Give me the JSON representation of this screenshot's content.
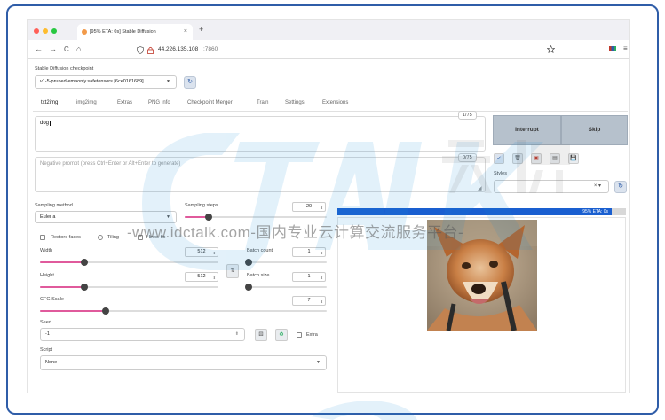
{
  "browser": {
    "tab_title": "[95% ETA: 0s] Stable Diffusion",
    "tab_close": "×",
    "new_tab": "+",
    "url_host": "44.226.135.108",
    "url_port": ":7860",
    "back": "←",
    "forward": "→",
    "reload": "C",
    "home": "⌂"
  },
  "checkpoint": {
    "label": "Stable Diffusion checkpoint",
    "value": "v1-5-pruned-emaonly.safetensors [6ce0161689]"
  },
  "tabs": [
    "txt2img",
    "img2img",
    "Extras",
    "PNG Info",
    "Checkpoint Merger",
    "Train",
    "Settings",
    "Extensions"
  ],
  "prompt": {
    "value": "dog",
    "counter": "1/75"
  },
  "negative_prompt": {
    "placeholder": "Negative prompt (press Ctrl+Enter or Alt+Enter to generate)",
    "counter": "0/75"
  },
  "buttons": {
    "interrupt": "Interrupt",
    "skip": "Skip"
  },
  "styles": {
    "label": "Styles",
    "clear": "× ▾"
  },
  "sampling": {
    "method_label": "Sampling method",
    "method_value": "Euler a",
    "steps_label": "Sampling steps",
    "steps_value": "20",
    "steps_fraction": 0.17
  },
  "checkboxes": {
    "restore_faces": "Restore faces",
    "tiling": "Tiling",
    "hires_fix": "Hires. fix"
  },
  "size": {
    "width_label": "Width",
    "width_value": "512",
    "width_fraction": 0.25,
    "height_label": "Height",
    "height_value": "512",
    "height_fraction": 0.25,
    "swap_icon": "⇅"
  },
  "batch": {
    "count_label": "Batch count",
    "count_value": "1",
    "size_label": "Batch size",
    "size_value": "1"
  },
  "cfg": {
    "label": "CFG Scale",
    "value": "7",
    "fraction": 0.23
  },
  "seed": {
    "label": "Seed",
    "value": "-1",
    "extra": "Extra"
  },
  "script": {
    "label": "Script",
    "value": "None"
  },
  "progress": {
    "text": "95% ETA: 0s",
    "fraction": 0.95
  },
  "watermark": {
    "domain": "-www.idctalk.com-国内专业云计算交流服务平台-"
  },
  "colors": {
    "accent": "#e05a9c",
    "progress": "#1a5fd0",
    "border": "#2f5da8"
  }
}
